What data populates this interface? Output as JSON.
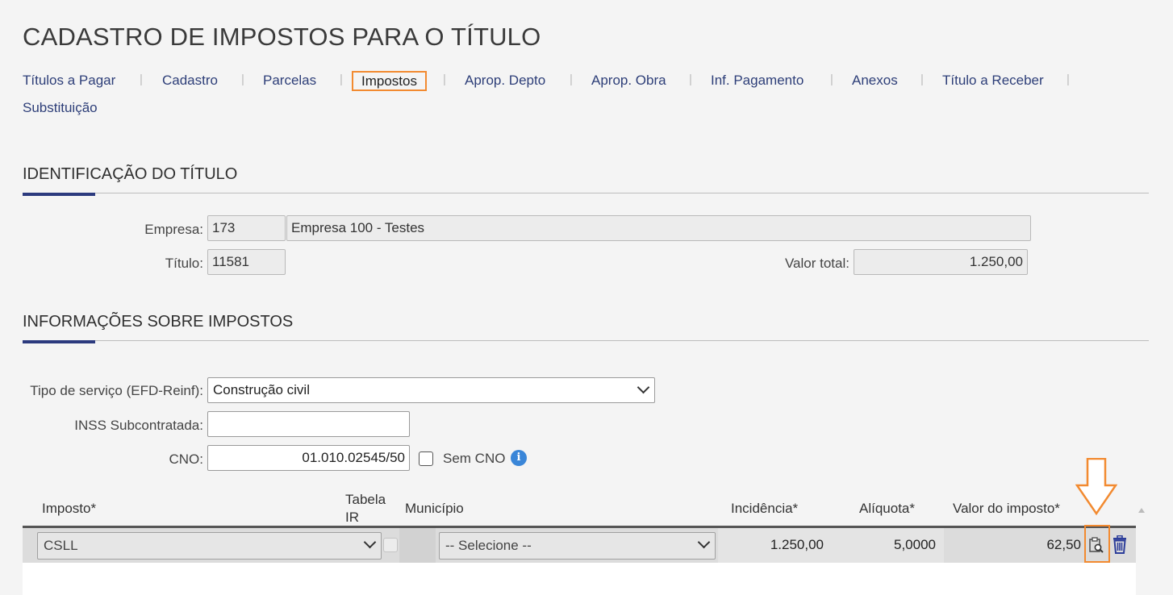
{
  "page": {
    "title": "CADASTRO DE IMPOSTOS PARA O TÍTULO"
  },
  "tabs": [
    {
      "label": "Títulos a Pagar"
    },
    {
      "label": "Cadastro"
    },
    {
      "label": "Parcelas"
    },
    {
      "label": "Impostos",
      "active": true
    },
    {
      "label": "Aprop. Depto"
    },
    {
      "label": "Aprop. Obra"
    },
    {
      "label": "Inf. Pagamento"
    },
    {
      "label": "Anexos"
    },
    {
      "label": "Título a Receber"
    },
    {
      "label": "Substituição"
    }
  ],
  "tab_separator": "|",
  "identificacao": {
    "title": "IDENTIFICAÇÃO DO TÍTULO",
    "empresa_label": "Empresa:",
    "empresa_code": "173",
    "empresa_name": "Empresa 100 - Testes",
    "titulo_label": "Título:",
    "titulo_value": "11581",
    "valor_total_label": "Valor total:",
    "valor_total_value": "1.250,00"
  },
  "impostos": {
    "title": "INFORMAÇÕES SOBRE IMPOSTOS",
    "tipo_servico_label": "Tipo de serviço (EFD-Reinf):",
    "tipo_servico_value": "Construção civil",
    "inss_label": "INSS Subcontratada:",
    "inss_value": "",
    "cno_label": "CNO:",
    "cno_value": "01.010.02545/50",
    "sem_cno_label": "Sem CNO",
    "info_icon_glyph": "i"
  },
  "grid": {
    "headers": {
      "imposto": "Imposto*",
      "tabela_ir_1": "Tabela",
      "tabela_ir_2": "IR",
      "municipio": "Município",
      "incidencia": "Incidência*",
      "aliquota": "Alíquota*",
      "valor": "Valor do imposto*"
    },
    "rows": [
      {
        "imposto": "CSLL",
        "municipio": "-- Selecione --",
        "incidencia": "1.250,00",
        "aliquota": "5,0000",
        "valor": "62,50"
      }
    ]
  },
  "colors": {
    "accent": "#2c3a7e",
    "highlight": "#f28a30",
    "link": "#2d3e78",
    "info": "#3a86d8",
    "trash": "#2d3e9a"
  },
  "icons": [
    "info-icon",
    "clipboard-search-icon",
    "trash-icon",
    "down-arrow-icon",
    "chevron-down-icon",
    "scroll-up-icon"
  ]
}
